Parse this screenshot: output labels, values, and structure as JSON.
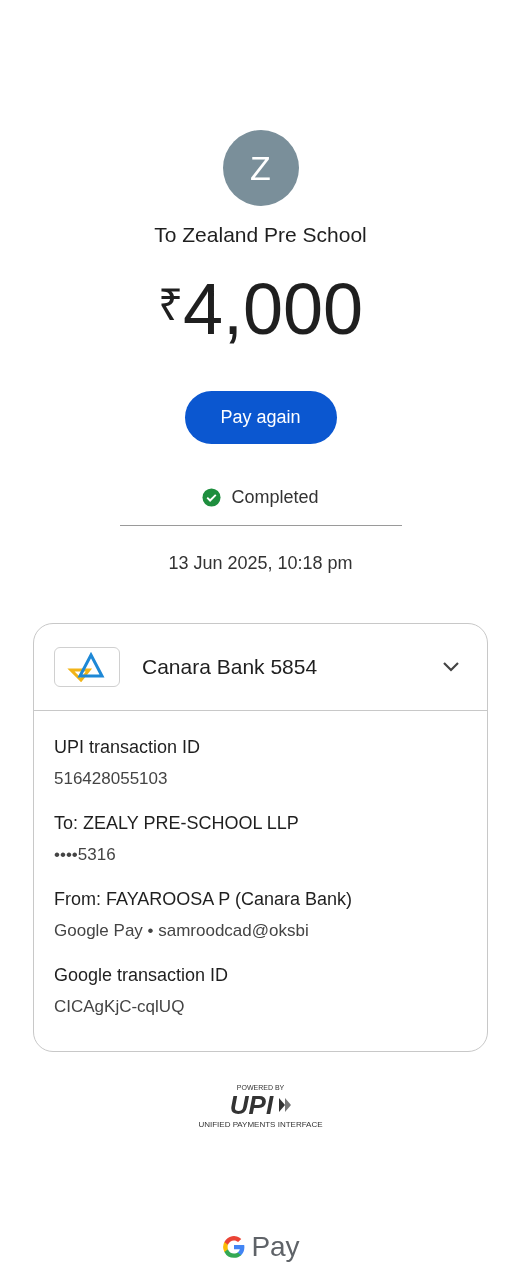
{
  "payee": {
    "avatar_letter": "Z",
    "title": "To Zealand Pre School"
  },
  "amount": {
    "currency": "₹",
    "value": "4,000"
  },
  "pay_again_button": "Pay again",
  "status": {
    "label": "Completed",
    "kind": "success"
  },
  "date": "13 Jun 2025, 10:18 pm",
  "details_card": {
    "bank": "Canara Bank 5854",
    "expanded": true,
    "rows": [
      {
        "label": "UPI transaction ID",
        "value": "516428055103"
      },
      {
        "label": "To: ZEALY PRE-SCHOOL LLP",
        "value": "••••5316"
      },
      {
        "label": "From: FAYAROOSA P (Canara Bank)",
        "value": "Google Pay • samroodcad@oksbi"
      },
      {
        "label": "Google transaction ID",
        "value": "CICAgKjC-cqlUQ"
      }
    ]
  },
  "upi_logo": {
    "caption": "POWERED BY",
    "mark": "UPI",
    "tagline": "UNIFIED PAYMENTS INTERFACE"
  },
  "footer_logo": {
    "text": "Pay"
  }
}
